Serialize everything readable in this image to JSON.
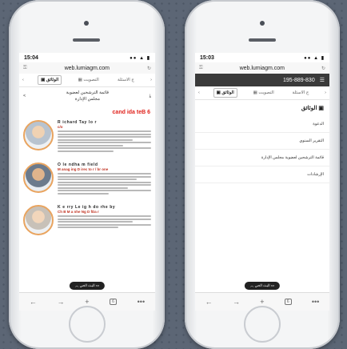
{
  "left_phone": {
    "status": {
      "time": "15:04",
      "icons": "●● ▲ ▮"
    },
    "url": "web.lumiagm.com",
    "tabs": [
      "ج الاسئلة",
      "التصويت",
      "الوثائق"
    ],
    "doc_title_line1": "قائمة الترشحين لعضوية",
    "doc_title_line2": "مجلس الإدارة",
    "banner": "cand ida teB 6",
    "people": [
      {
        "name": "R ichard Tay lo r",
        "role": "c/o"
      },
      {
        "name": "O le ndha m field",
        "role": "M anag ing D irec to r / br one"
      },
      {
        "name": "K e rry Le ig h do rhe by",
        "role": "Ch B M a nhe Ng D  fDa r"
      }
    ],
    "float_button": "البث الحي",
    "bottom_bar": [
      "←",
      "→",
      "+",
      "6",
      "•••"
    ]
  },
  "right_phone": {
    "status": {
      "time": "15:03",
      "icons": "●● ▲ ▮"
    },
    "url": "web.lumiagm.com",
    "title": "195-889-830",
    "tabs": [
      "ج الاسئلة",
      "التصويت",
      "الوثائق"
    ],
    "section": "الوثائق",
    "items": [
      "الدعوة",
      "التقرير السنوي",
      "قائمة الترشحين لعضوية مجلس الإدارة",
      "الإرشادات"
    ],
    "float_button": "البث الحي",
    "bottom_bar": [
      "←",
      "→",
      "+",
      "6",
      "•••"
    ]
  }
}
